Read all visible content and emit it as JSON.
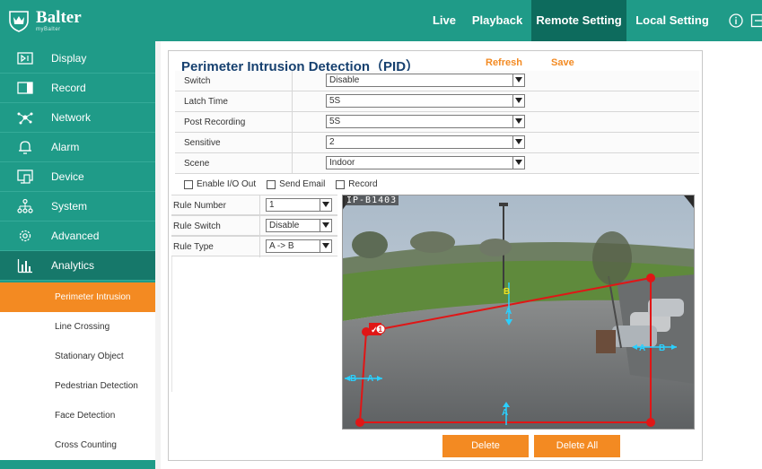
{
  "header": {
    "brand": "Balter",
    "brand_sub": "myBalter",
    "nav": {
      "live": "Live",
      "playback": "Playback",
      "remote_setting": "Remote Setting",
      "local_setting": "Local Setting"
    },
    "active_nav": "Remote Setting",
    "icons": [
      "info-icon",
      "exit-icon"
    ]
  },
  "sidebar": {
    "items": [
      {
        "label": "Display",
        "icon": "display-icon"
      },
      {
        "label": "Record",
        "icon": "record-icon"
      },
      {
        "label": "Network",
        "icon": "network-icon"
      },
      {
        "label": "Alarm",
        "icon": "alarm-bell-icon"
      },
      {
        "label": "Device",
        "icon": "device-icon"
      },
      {
        "label": "System",
        "icon": "system-tree-icon"
      },
      {
        "label": "Advanced",
        "icon": "advanced-gear-icon"
      },
      {
        "label": "Analytics",
        "icon": "analytics-chart-icon"
      }
    ],
    "active_item": "Analytics",
    "sub_items": [
      "Perimeter Intrusion",
      "Line Crossing",
      "Stationary Object",
      "Pedestrian Detection",
      "Face Detection",
      "Cross Counting"
    ],
    "active_sub_item": "Perimeter Intrusion"
  },
  "main": {
    "title": "Perimeter Intrusion Detection（PID）",
    "refresh": "Refresh",
    "save": "Save",
    "settings": [
      {
        "label": "Switch",
        "value": "Disable"
      },
      {
        "label": "Latch Time",
        "value": "5S"
      },
      {
        "label": "Post Recording",
        "value": "5S"
      },
      {
        "label": "Sensitive",
        "value": "2"
      },
      {
        "label": "Scene",
        "value": "Indoor"
      }
    ],
    "checkboxes": [
      {
        "label": "Enable I/O Out",
        "checked": false
      },
      {
        "label": "Send Email",
        "checked": false
      },
      {
        "label": "Record",
        "checked": false
      }
    ],
    "rules": [
      {
        "label": "Rule Number",
        "value": "1"
      },
      {
        "label": "Rule Switch",
        "value": "Disable"
      },
      {
        "label": "Rule Type",
        "value": "A -> B"
      }
    ],
    "camera_label": "IP-B1403",
    "zone_number": "1",
    "zone_markers": {
      "a": "A",
      "b": "B"
    },
    "delete": "Delete",
    "delete_all": "Delete All"
  },
  "colors": {
    "primary": "#1f9b88",
    "primary_dark": "#0d6b5d",
    "accent": "#f38a22",
    "title": "#16406f",
    "zone_line": "#e01616",
    "zone_marker": "#2ad0ff",
    "zone_marker_b": "#f0e21e"
  }
}
